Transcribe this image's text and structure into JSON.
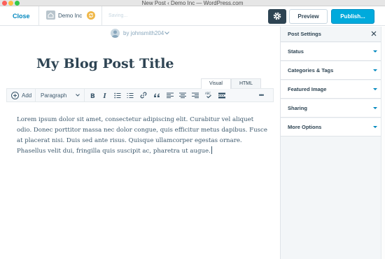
{
  "window": {
    "title": "New Post ‹ Demo Inc — WordPress.com"
  },
  "header": {
    "close_label": "Close",
    "site_name": "Demo Inc",
    "saving_text": "Saving...",
    "preview_label": "Preview",
    "publish_label": "Publish..."
  },
  "author": {
    "byline": "by johnsmith204"
  },
  "post": {
    "title": "My Blog Post Title",
    "body": "Lorem ipsum dolor sit amet, consectetur adipiscing elit. Curabitur vel aliquet odio. Donec porttitor massa nec dolor congue, quis efficitur metus dapibus. Fusce at placerat nisi. Duis sed ante risus. Quisque ullamcorper egestas ornare. Phasellus velit dui, fringilla quis suscipit ac, pharetra ut augue."
  },
  "editor_tabs": {
    "visual": "Visual",
    "html": "HTML"
  },
  "toolbar": {
    "add_label": "Add",
    "format_label": "Paragraph",
    "more": "•••"
  },
  "sidebar": {
    "title": "Post Settings",
    "sections": [
      {
        "label": "Status"
      },
      {
        "label": "Categories & Tags"
      },
      {
        "label": "Featured Image"
      },
      {
        "label": "Sharing"
      },
      {
        "label": "More Options"
      }
    ]
  },
  "colors": {
    "accent": "#00aadc",
    "link": "#0087be",
    "dark": "#2e4453"
  }
}
